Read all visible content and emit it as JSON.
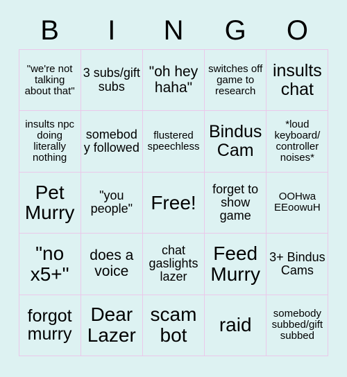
{
  "card": {
    "header_letters": [
      "B",
      "I",
      "N",
      "G",
      "O"
    ],
    "rows": [
      [
        {
          "text": "\"we're not talking about that\"",
          "size": "fs-s"
        },
        {
          "text": "3 subs/gift subs",
          "size": "fs-m"
        },
        {
          "text": "\"oh hey haha\"",
          "size": "fs-l"
        },
        {
          "text": "switches off game to research",
          "size": "fs-s"
        },
        {
          "text": "insults chat",
          "size": "fs-xl"
        }
      ],
      [
        {
          "text": "insults npc doing literally nothing",
          "size": "fs-s"
        },
        {
          "text": "somebody followed",
          "size": "fs-m"
        },
        {
          "text": "flustered speechless",
          "size": "fs-s"
        },
        {
          "text": "Bindus Cam",
          "size": "fs-xl"
        },
        {
          "text": "*loud keyboard/ controller noises*",
          "size": "fs-s"
        }
      ],
      [
        {
          "text": "Pet Murry",
          "size": "fs-xxl"
        },
        {
          "text": "\"you people\"",
          "size": "fs-m"
        },
        {
          "text": "Free!",
          "size": "fs-xxl"
        },
        {
          "text": "forget to show game",
          "size": "fs-m"
        },
        {
          "text": "OOHwa EEoowuH",
          "size": "fs-s"
        }
      ],
      [
        {
          "text": "\"no x5+\"",
          "size": "fs-xxl"
        },
        {
          "text": "does a voice",
          "size": "fs-l"
        },
        {
          "text": "chat gaslights lazer",
          "size": "fs-m"
        },
        {
          "text": "Feed Murry",
          "size": "fs-xxl"
        },
        {
          "text": "3+ Bindus Cams",
          "size": "fs-m"
        }
      ],
      [
        {
          "text": "forgot murry",
          "size": "fs-xl"
        },
        {
          "text": "Dear Lazer",
          "size": "fs-xxl"
        },
        {
          "text": "scam bot",
          "size": "fs-xxl"
        },
        {
          "text": "raid",
          "size": "fs-xxl"
        },
        {
          "text": "somebody subbed/gift subbed",
          "size": "fs-s"
        }
      ]
    ]
  },
  "colors": {
    "background": "#ddf2f2",
    "cell_fill": "#ddf2f2",
    "cell_border": "#eac8ea",
    "text": "#000000"
  }
}
